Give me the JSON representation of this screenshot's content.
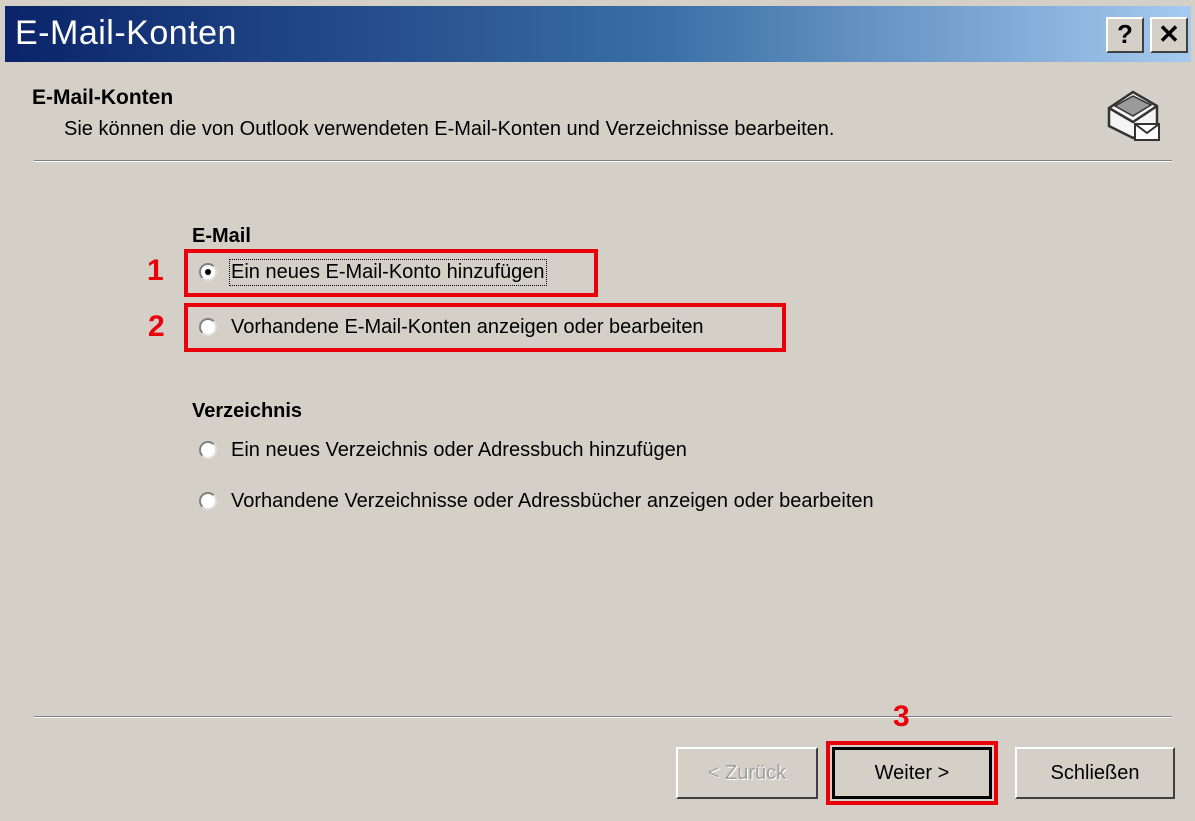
{
  "window": {
    "title": "E-Mail-Konten",
    "help_button": "?",
    "close_button": "✕"
  },
  "header": {
    "title": "E-Mail-Konten",
    "description": "Sie können die von Outlook verwendeten E-Mail-Konten und Verzeichnisse bearbeiten.",
    "icon": "mail-envelope-icon"
  },
  "email_group": {
    "label": "E-Mail",
    "options": [
      {
        "label": "Ein neues E-Mail-Konto hinzufügen",
        "checked": true
      },
      {
        "label": "Vorhandene E-Mail-Konten anzeigen oder bearbeiten",
        "checked": false
      }
    ]
  },
  "directory_group": {
    "label": "Verzeichnis",
    "options": [
      {
        "label": "Ein neues Verzeichnis oder Adressbuch hinzufügen",
        "checked": false
      },
      {
        "label": "Vorhandene Verzeichnisse oder Adressbücher anzeigen oder bearbeiten",
        "checked": false
      }
    ]
  },
  "annotations": {
    "marker_1": "1",
    "marker_2": "2",
    "marker_3": "3",
    "highlight_color": "#e8000b"
  },
  "buttons": {
    "back": "< Zurück",
    "next": "Weiter >",
    "close": "Schließen"
  }
}
